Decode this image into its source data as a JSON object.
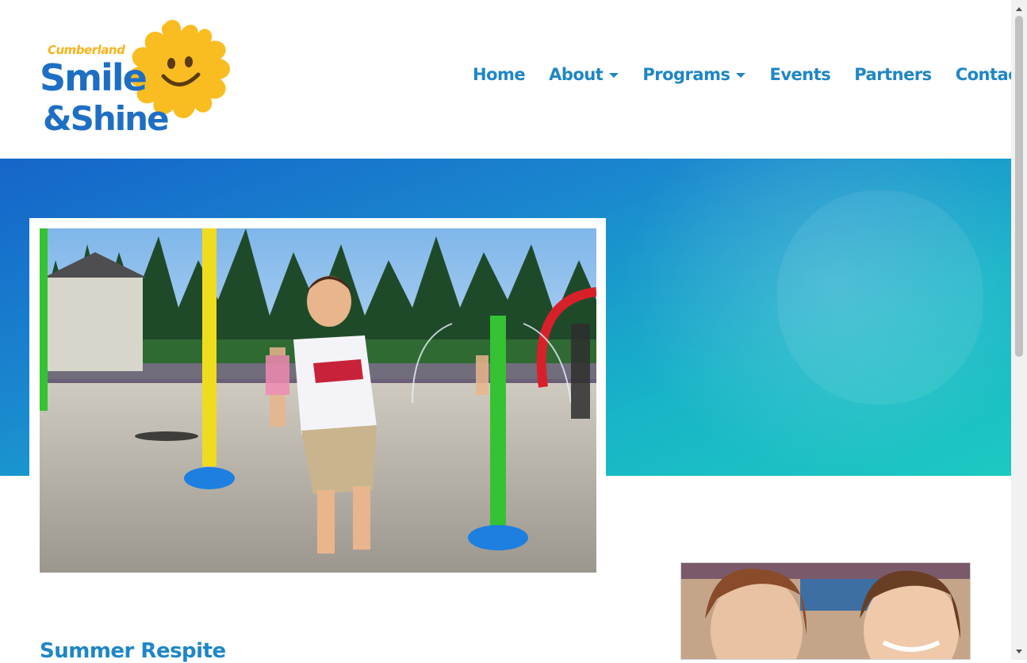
{
  "brand": {
    "logo_line1": "Cumberland",
    "logo_line2": "Smile",
    "logo_line3": "&Shine",
    "colors": {
      "blue": "#1e6fc4",
      "yellow": "#f6b41a",
      "nav": "#1e86c6"
    }
  },
  "nav": {
    "items": [
      {
        "label": "Home",
        "dropdown": false
      },
      {
        "label": "About",
        "dropdown": true
      },
      {
        "label": "Programs",
        "dropdown": true
      },
      {
        "label": "Events",
        "dropdown": true
      },
      {
        "label": "Partners",
        "dropdown": false
      },
      {
        "label": "Contact",
        "dropdown": false
      }
    ]
  },
  "main": {
    "section_title": "Summer Respite"
  },
  "icons": {
    "dropdown": "caret-down-icon",
    "scroll_up": "arrow-up-icon",
    "scroll_down": "arrow-down-icon"
  }
}
